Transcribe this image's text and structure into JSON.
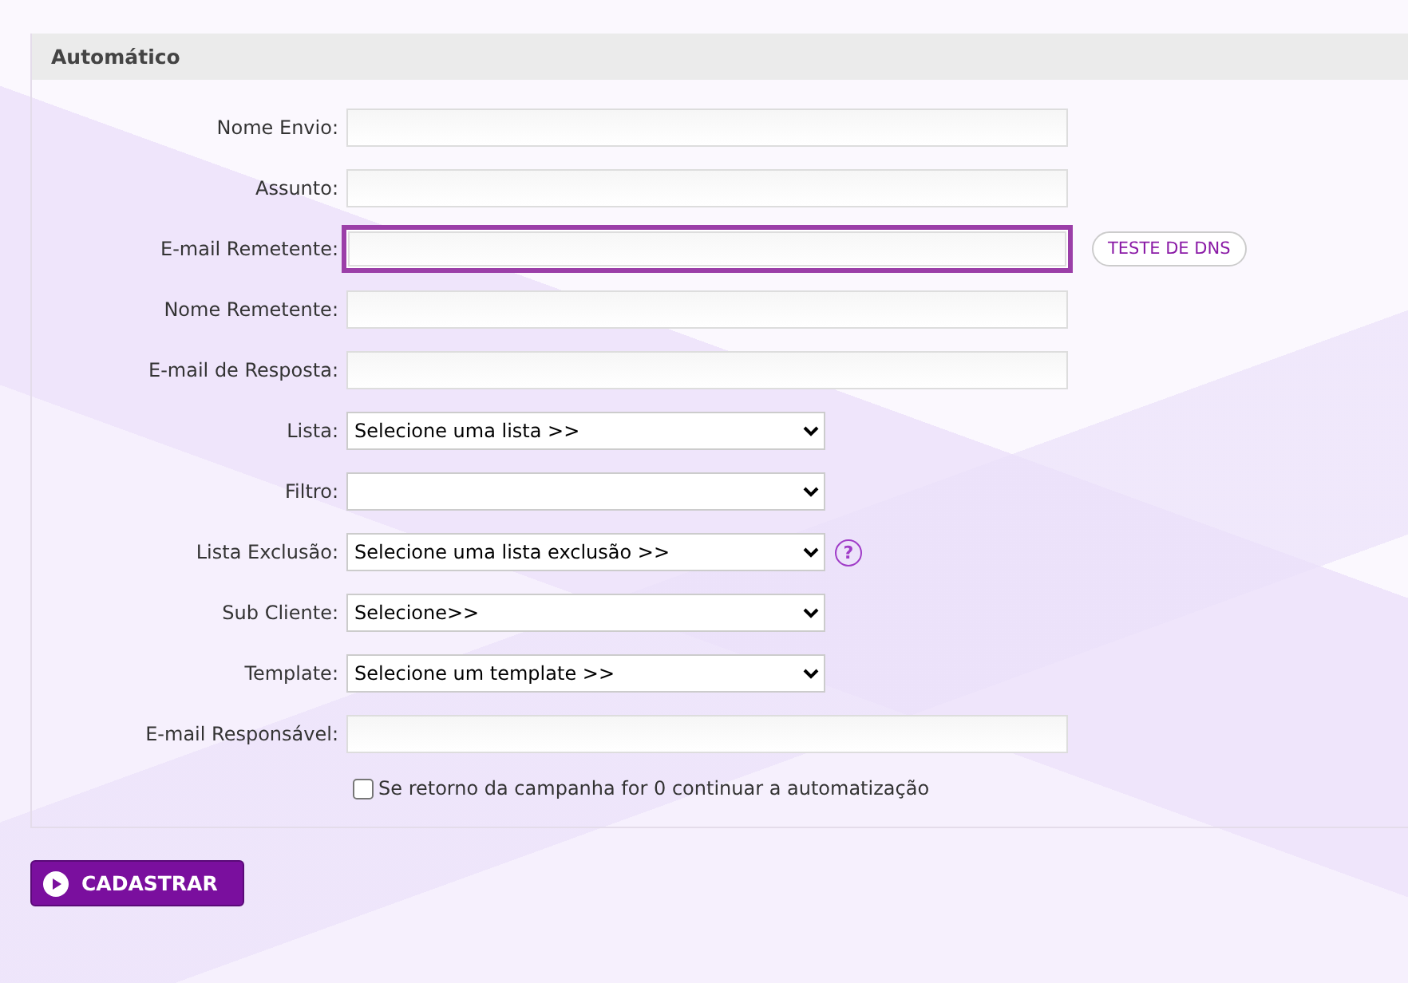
{
  "section": {
    "title": "Automático"
  },
  "fields": [
    {
      "kind": "input",
      "label": "Nome Envio:",
      "focused": false
    },
    {
      "kind": "input",
      "label": "Assunto:",
      "focused": false
    },
    {
      "kind": "input",
      "label": "E-mail Remetente:",
      "focused": true,
      "action": "TESTE DE DNS"
    },
    {
      "kind": "input",
      "label": "Nome Remetente:",
      "focused": false
    },
    {
      "kind": "input",
      "label": "E-mail de Resposta:",
      "focused": false
    },
    {
      "kind": "select",
      "label": "Lista:",
      "value": "Selecione uma lista >>"
    },
    {
      "kind": "select",
      "label": "Filtro:"
    },
    {
      "kind": "select",
      "label": "Lista Exclusão:",
      "value": "Selecione uma lista exclusão >>",
      "help": "?"
    },
    {
      "kind": "select",
      "label": "Sub Cliente:",
      "value": "Selecione>>"
    },
    {
      "kind": "select",
      "label": "Template:",
      "value": "Selecione um template >>"
    },
    {
      "kind": "input",
      "label": "E-mail Responsável:",
      "focused": false
    }
  ],
  "option": {
    "label": "Se retorno da campanha for 0 continuar a automatização",
    "checked": false
  },
  "submit": {
    "label": "CADASTRAR"
  }
}
